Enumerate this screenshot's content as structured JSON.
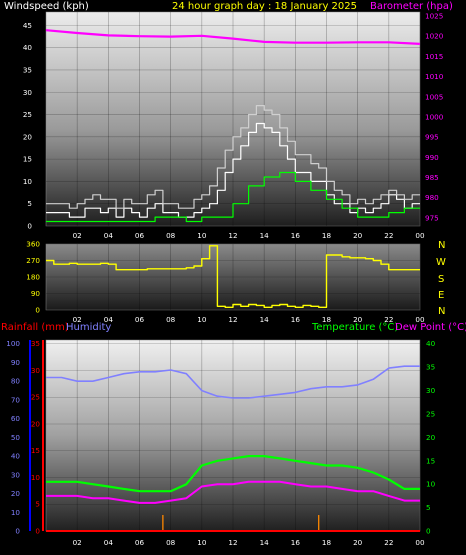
{
  "header": {
    "title": "24 hour graph day : 18 January 2025",
    "left_label": "Windspeed (kph)",
    "right_label": "Barometer (hpa)",
    "rain_label": "Rainfall (mm)",
    "humidity_label": "Humidity",
    "temp_label": "Temperature (°C)",
    "dew_label": "Dew Point (°C)"
  },
  "colors": {
    "background": "#000000",
    "windspeed": "#ffffff",
    "barometer": "#ff00ff",
    "direction": "#ffff00",
    "rainfall": "#ff0000",
    "humidity": "#8080ff",
    "temperature": "#00ff00",
    "dewpoint": "#ff00ff",
    "rain_scale": "#ff0000",
    "humidity_scale": "#0000ff"
  },
  "x_hours": [
    "02",
    "04",
    "06",
    "08",
    "10",
    "12",
    "14",
    "16",
    "18",
    "20",
    "22",
    "00"
  ],
  "compass": [
    "N",
    "W",
    "S",
    "E",
    "N"
  ],
  "chart_data": [
    {
      "type": "line",
      "title": "24 hour graph day : 18 January 2025",
      "x_range": [
        0,
        24
      ],
      "y_left_label": "Windspeed (kph)",
      "y_left_ticks": [
        "0",
        "5",
        "10",
        "15",
        "20",
        "25",
        "30",
        "35",
        "40",
        "45"
      ],
      "y_left_range": [
        0,
        48
      ],
      "y_right_label": "Barometer (hpa)",
      "y_right_ticks": [
        "975",
        "980",
        "985",
        "990",
        "995",
        "1000",
        "1005",
        "1010",
        "1015",
        "1020",
        "1025"
      ],
      "y_right_range": [
        973,
        1026
      ],
      "series": [
        {
          "name": "Windspeed (kph)",
          "axis": "left",
          "color": "#ffffff",
          "x": [
            0,
            0.5,
            1,
            1.5,
            2,
            2.5,
            3,
            3.5,
            4,
            4.5,
            5,
            5.5,
            6,
            6.5,
            7,
            7.5,
            8,
            8.5,
            9,
            9.5,
            10,
            10.5,
            11,
            11.5,
            12,
            12.5,
            13,
            13.5,
            14,
            14.5,
            15,
            15.5,
            16,
            16.5,
            17,
            17.5,
            18,
            18.5,
            19,
            19.5,
            20,
            20.5,
            21,
            21.5,
            22,
            22.5,
            23,
            23.5,
            24
          ],
          "values": [
            3,
            3,
            3,
            2,
            2,
            4,
            4,
            3,
            4,
            2,
            4,
            3,
            2,
            4,
            5,
            3,
            3,
            2,
            2,
            3,
            4,
            5,
            8,
            12,
            15,
            18,
            21,
            23,
            22,
            21,
            18,
            15,
            12,
            12,
            10,
            10,
            7,
            5,
            5,
            3,
            4,
            3,
            4,
            5,
            7,
            6,
            4,
            5,
            5
          ]
        },
        {
          "name": "Gust",
          "axis": "left",
          "color": "#d0d0d0",
          "x": [
            0,
            0.5,
            1,
            1.5,
            2,
            2.5,
            3,
            3.5,
            4,
            4.5,
            5,
            5.5,
            6,
            6.5,
            7,
            7.5,
            8,
            8.5,
            9,
            9.5,
            10,
            10.5,
            11,
            11.5,
            12,
            12.5,
            13,
            13.5,
            14,
            14.5,
            15,
            15.5,
            16,
            16.5,
            17,
            17.5,
            18,
            18.5,
            19,
            19.5,
            20,
            20.5,
            21,
            21.5,
            22,
            22.5,
            23,
            23.5,
            24
          ],
          "values": [
            5,
            5,
            5,
            4,
            5,
            6,
            7,
            6,
            6,
            4,
            6,
            5,
            5,
            7,
            8,
            5,
            5,
            4,
            4,
            6,
            7,
            9,
            13,
            17,
            20,
            22,
            25,
            27,
            26,
            25,
            22,
            19,
            16,
            16,
            14,
            13,
            10,
            8,
            7,
            5,
            6,
            5,
            6,
            7,
            8,
            7,
            6,
            7,
            7
          ]
        },
        {
          "name": "Average",
          "axis": "left",
          "color": "#00ff00",
          "x": [
            0,
            1,
            2,
            3,
            4,
            5,
            6,
            7,
            8,
            9,
            10,
            11,
            12,
            13,
            14,
            15,
            16,
            17,
            18,
            19,
            20,
            21,
            22,
            23,
            24
          ],
          "values": [
            1,
            1,
            1,
            1,
            1,
            1,
            1,
            2,
            2,
            1,
            2,
            2,
            5,
            9,
            11,
            12,
            10,
            8,
            6,
            4,
            2,
            2,
            3,
            4,
            4
          ]
        },
        {
          "name": "Barometer (hpa)",
          "axis": "right",
          "color": "#ff00ff",
          "x": [
            0,
            2,
            4,
            6,
            8,
            10,
            12,
            14,
            16,
            18,
            20,
            22,
            24
          ],
          "values": [
            1021.5,
            1020.8,
            1020.2,
            1020,
            1019.9,
            1020.1,
            1019.4,
            1018.6,
            1018.4,
            1018.4,
            1018.5,
            1018.5,
            1018.1
          ]
        }
      ]
    },
    {
      "type": "scatter",
      "title": "Wind direction",
      "x_range": [
        0,
        24
      ],
      "y_ticks": [
        "0",
        "90",
        "180",
        "270",
        "360"
      ],
      "y_range": [
        0,
        360
      ],
      "series": [
        {
          "name": "Wind direction",
          "color": "#ffff00",
          "x": [
            0,
            0.5,
            1,
            1.5,
            2,
            2.5,
            3,
            3.5,
            4,
            4.5,
            5,
            5.5,
            6,
            6.5,
            7,
            7.5,
            8,
            8.5,
            9,
            9.5,
            10,
            10.5,
            11,
            11.5,
            12,
            12.5,
            13,
            13.5,
            14,
            14.5,
            15,
            15.5,
            16,
            16.5,
            17,
            17.5,
            18,
            18.5,
            19,
            19.5,
            20,
            20.5,
            21,
            21.5,
            22,
            22.5,
            23,
            23.5,
            24
          ],
          "values": [
            270,
            250,
            250,
            255,
            250,
            250,
            250,
            255,
            250,
            220,
            220,
            220,
            220,
            225,
            225,
            225,
            225,
            225,
            230,
            240,
            280,
            350,
            20,
            15,
            30,
            20,
            30,
            25,
            15,
            25,
            30,
            20,
            15,
            25,
            20,
            15,
            300,
            300,
            290,
            285,
            285,
            280,
            270,
            250,
            220,
            220,
            220,
            220,
            220
          ]
        }
      ]
    },
    {
      "type": "line",
      "title": "",
      "x_range": [
        0,
        24
      ],
      "y_left_label": "Humidity",
      "y_left_ticks": [
        "0",
        "10",
        "20",
        "30",
        "40",
        "50",
        "60",
        "70",
        "80",
        "90",
        "100"
      ],
      "y_left_range": [
        0,
        102
      ],
      "y_rain_label": "Rainfall (mm)",
      "y_rain_ticks": [
        "0",
        "5",
        "10",
        "15",
        "20",
        "25",
        "30",
        "35"
      ],
      "y_rain_range": [
        0,
        35.7
      ],
      "y_right_label": "Temperature (°C) / Dew Point (°C)",
      "y_right_ticks": [
        "0",
        "5",
        "10",
        "15",
        "20",
        "25",
        "30",
        "35",
        "40"
      ],
      "y_right_range": [
        0,
        40.8
      ],
      "series": [
        {
          "name": "Humidity",
          "axis": "left",
          "color": "#8080ff",
          "x": [
            0,
            1,
            2,
            3,
            4,
            5,
            6,
            7,
            8,
            9,
            10,
            11,
            12,
            13,
            14,
            15,
            16,
            17,
            18,
            19,
            20,
            21,
            22,
            23,
            24
          ],
          "values": [
            82,
            82,
            80,
            80,
            82,
            84,
            85,
            85,
            86,
            84,
            75,
            72,
            71,
            71,
            72,
            73,
            74,
            76,
            77,
            77,
            78,
            81,
            87,
            88,
            88
          ]
        },
        {
          "name": "Temperature (°C)",
          "axis": "right",
          "color": "#00ff00",
          "x": [
            0,
            1,
            2,
            3,
            4,
            5,
            6,
            7,
            8,
            9,
            10,
            11,
            12,
            13,
            14,
            15,
            16,
            17,
            18,
            19,
            20,
            21,
            22,
            23,
            24
          ],
          "values": [
            10.5,
            10.5,
            10.5,
            10,
            9.5,
            9,
            8.5,
            8.5,
            8.5,
            10,
            14,
            15,
            15.5,
            16,
            16,
            15.5,
            15,
            14.5,
            14,
            14,
            13.5,
            12.5,
            11,
            9,
            9
          ]
        },
        {
          "name": "Dew Point (°C)",
          "axis": "right",
          "color": "#ff00ff",
          "x": [
            0,
            1,
            2,
            3,
            4,
            5,
            6,
            7,
            8,
            9,
            10,
            11,
            12,
            13,
            14,
            15,
            16,
            17,
            18,
            19,
            20,
            21,
            22,
            23,
            24
          ],
          "values": [
            7.5,
            7.5,
            7.5,
            7,
            7,
            6.5,
            6,
            6,
            6.5,
            7,
            9.5,
            10,
            10,
            10.5,
            10.5,
            10.5,
            10,
            9.5,
            9.5,
            9,
            8.5,
            8.5,
            7.5,
            6.5,
            6.5
          ]
        },
        {
          "name": "Rainfall (mm)",
          "axis": "rain",
          "color": "#ff0000",
          "x": [
            0,
            24
          ],
          "values": [
            0,
            0
          ]
        }
      ]
    }
  ]
}
